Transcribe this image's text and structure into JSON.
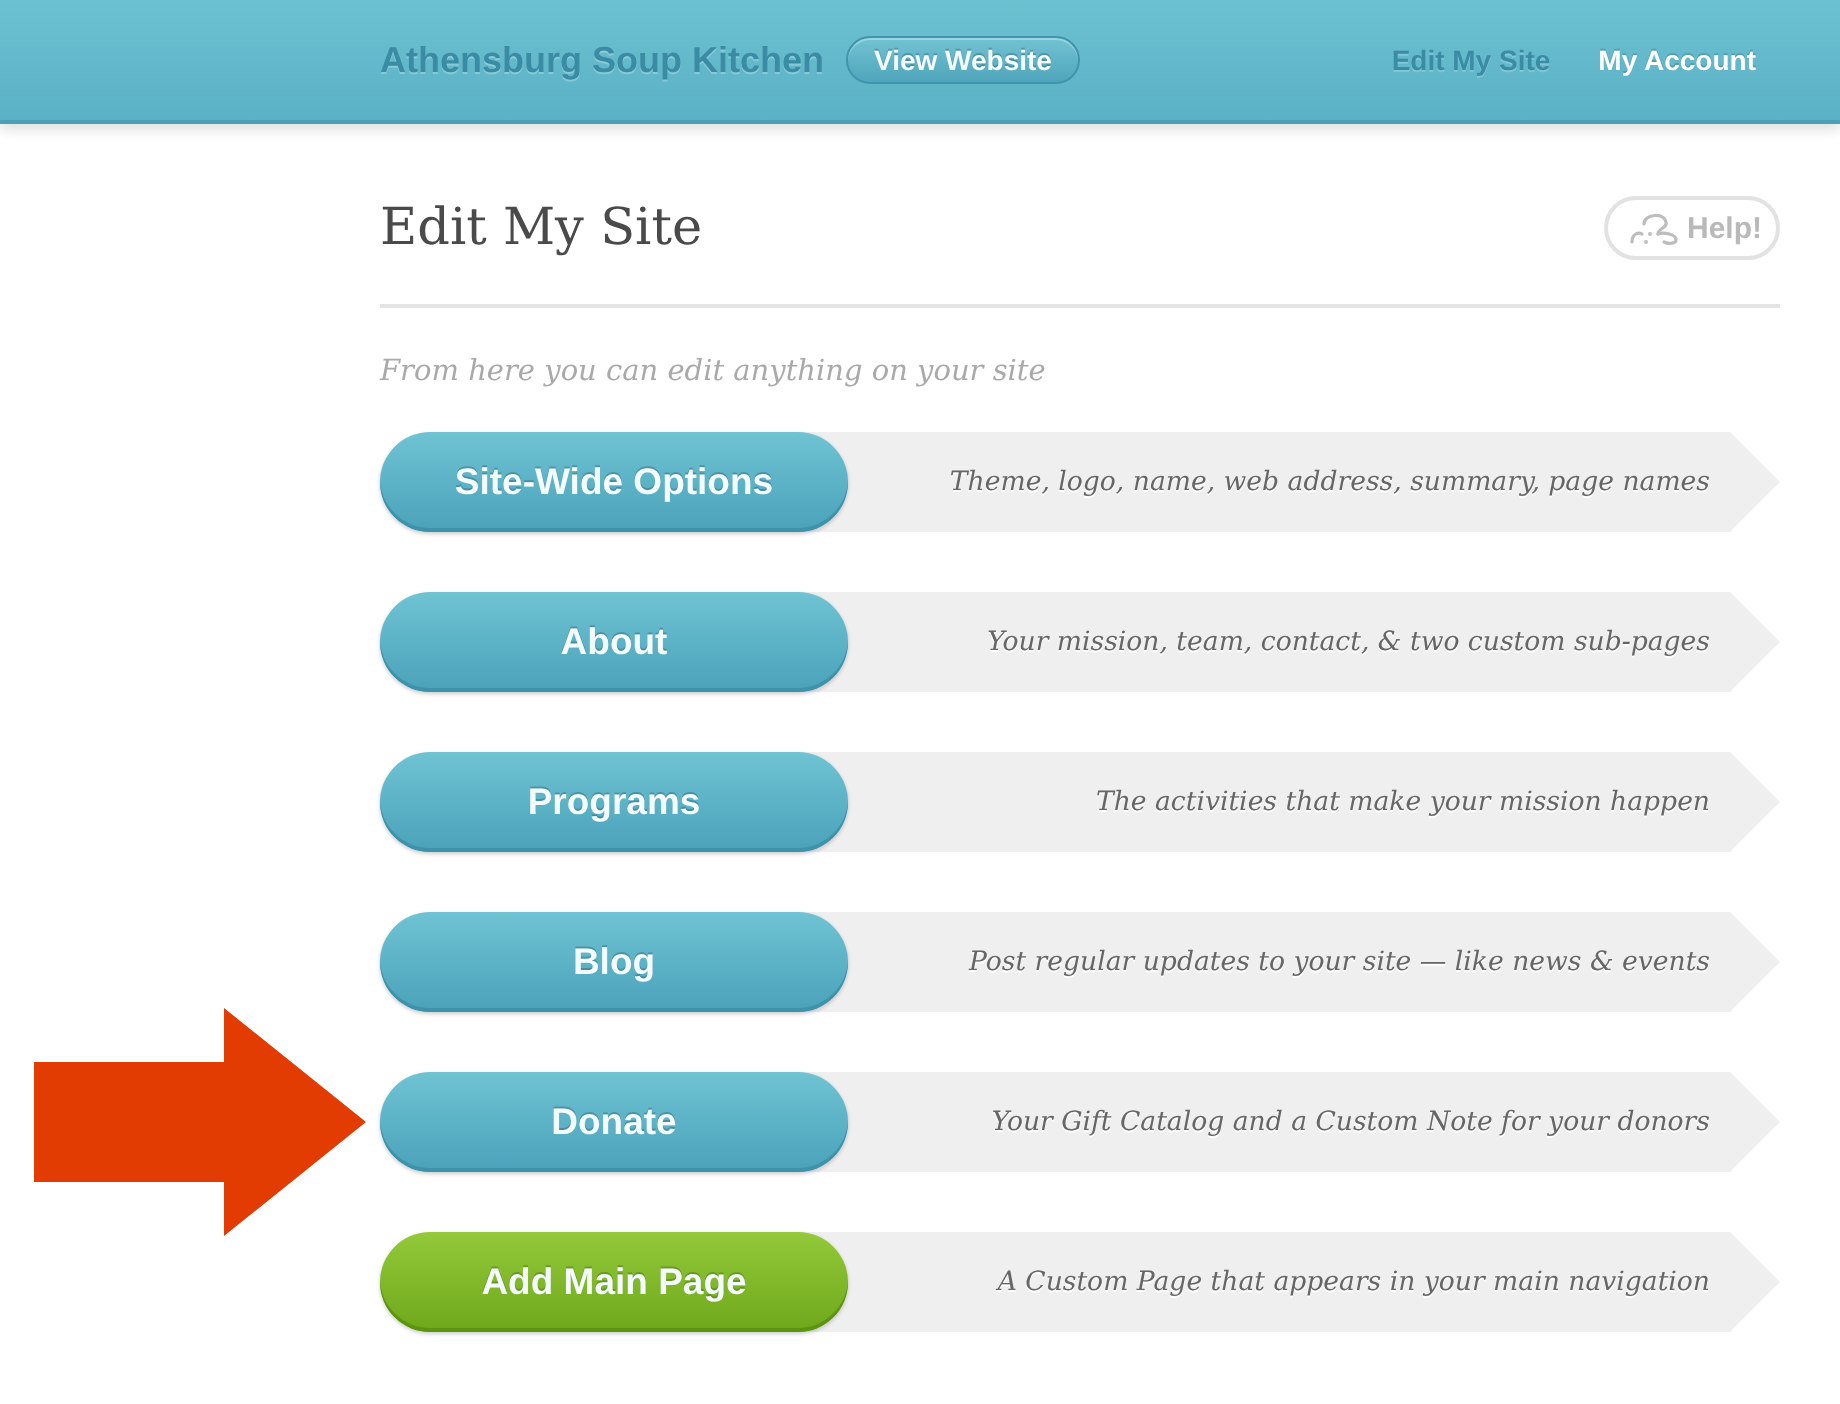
{
  "header": {
    "site_name": "Athensburg Soup Kitchen",
    "view_button": "View Website",
    "nav": [
      {
        "label": "Edit My Site",
        "selected": true
      },
      {
        "label": "My Account",
        "selected": false
      }
    ]
  },
  "page": {
    "title": "Edit My Site",
    "help_button": "Help!",
    "intro": "From here you can edit anything on your site"
  },
  "sections": [
    {
      "kind": "section",
      "label": "Site-Wide Options",
      "description": "Theme, logo, name, web address, summary, page names",
      "highlighted": false
    },
    {
      "kind": "section",
      "label": "About",
      "description": "Your mission, team, contact, & two custom sub-pages",
      "highlighted": false
    },
    {
      "kind": "section",
      "label": "Programs",
      "description": "The activities that make your mission happen",
      "highlighted": false
    },
    {
      "kind": "section",
      "label": "Blog",
      "description": "Post regular updates to your site — like news & events",
      "highlighted": false
    },
    {
      "kind": "section",
      "label": "Donate",
      "description": "Your Gift Catalog and a Custom Note for your donors",
      "highlighted": true
    },
    {
      "kind": "add",
      "label": "Add Main Page",
      "description": "A Custom Page that appears in your main navigation",
      "highlighted": false
    }
  ]
}
